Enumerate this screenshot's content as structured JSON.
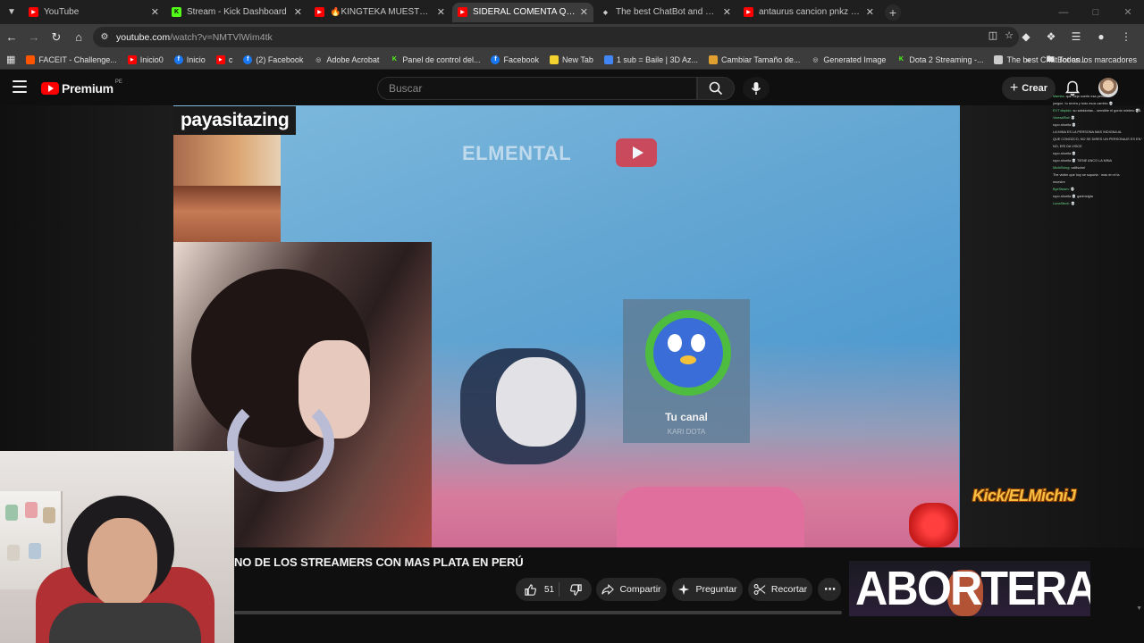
{
  "browser": {
    "tabs": [
      {
        "title": "YouTube",
        "icon": "youtube-favicon",
        "color": "#ff0000",
        "active": false
      },
      {
        "title": "Stream - Kick Dashboard",
        "icon": "kick-favicon",
        "color": "#53fc18",
        "active": false
      },
      {
        "title": "🔥KINGTEKA MUESTRA QUE M",
        "icon": "youtube-favicon",
        "color": "#ff0000",
        "active": false
      },
      {
        "title": "SIDERAL COMENTA QUE ZEIN E",
        "icon": "youtube-favicon",
        "color": "#ff0000",
        "active": true
      },
      {
        "title": "The best ChatBot and Widgets",
        "icon": "botrix-favicon",
        "color": "#cccccc",
        "active": false
      },
      {
        "title": "antaurus cancion pnkz - YouTu",
        "icon": "youtube-favicon",
        "color": "#ff0000",
        "active": false
      }
    ],
    "url_domain": "youtube.com",
    "url_path": "/watch?v=NMTVlWim4tk",
    "bookmarks": [
      {
        "label": "FACEIT - Challenge...",
        "icon": "faceit-icon",
        "color": "#ff5500"
      },
      {
        "label": "Inicio0",
        "icon": "youtube-icon",
        "color": "#ff0000"
      },
      {
        "label": "Inicio",
        "icon": "facebook-icon",
        "color": "#1877f2"
      },
      {
        "label": "c",
        "icon": "youtube-icon",
        "color": "#ff0000"
      },
      {
        "label": "(2) Facebook",
        "icon": "facebook-icon",
        "color": "#1877f2"
      },
      {
        "label": "Adobe Acrobat",
        "icon": "globe-icon",
        "color": "#9a9a9a"
      },
      {
        "label": "Panel de control del...",
        "icon": "kick-icon",
        "color": "#53fc18"
      },
      {
        "label": "Facebook",
        "icon": "facebook-icon",
        "color": "#1877f2"
      },
      {
        "label": "New Tab",
        "icon": "pixel-icon",
        "color": "#f2d22e"
      },
      {
        "label": "1 sub = Baile | 3D Az...",
        "icon": "translate-icon",
        "color": "#4285f4"
      },
      {
        "label": "Cambiar Tamaño de...",
        "icon": "dots-icon",
        "color": "#e0a030"
      },
      {
        "label": "Generated Image",
        "icon": "globe-icon",
        "color": "#9a9a9a"
      },
      {
        "label": "Dota 2 Streaming -...",
        "icon": "kick-icon",
        "color": "#53fc18"
      },
      {
        "label": "The best ChatBot an...",
        "icon": "botrix-icon",
        "color": "#cccccc"
      }
    ],
    "all_bookmarks_label": "Todos los marcadores"
  },
  "youtube": {
    "logo_text": "Premium",
    "logo_region": "PE",
    "search_placeholder": "Buscar",
    "create_label": "Crear",
    "video_title": "NO DE LOS STREAMERS CON MAS PLATA EN PERÚ",
    "like_count": "51",
    "share_label": "Compartir",
    "ask_label": "Preguntar",
    "clip_label": "Recortar"
  },
  "video_overlay": {
    "streamer_name": "payasitazing",
    "channel_watermark": "ELMENTAL",
    "sub_card_title": "Tu canal",
    "sub_card_sub": "KARI DOTA",
    "kick_tag": "Kick/ELMichiJ",
    "banner_text": "ABORTERA",
    "chat": [
      {
        "user": "Mamita",
        "msg": "que vieja suerte esa persona"
      },
      {
        "user": "",
        "msg": "juegue, tu sirvira y todo esos cambio 💀"
      },
      {
        "user": "EVT dispido",
        "msg": "su sabidurias... sensible el gordo mistero 💀"
      },
      {
        "user": "VioesaRiot",
        "msg": "💀"
      },
      {
        "user": "",
        "msg": "ropo ahorita 💀"
      },
      {
        "user": "",
        "msg": "LA MINA ES LA PERSONA MAS INDIGNA AL"
      },
      {
        "user": "",
        "msg": "QUE CONOZCO, NO SE DIRES UN PERSONAJE ES EN VIDA"
      },
      {
        "user": "",
        "msg": "NO, ERI DA VISCE"
      },
      {
        "user": "",
        "msg": "ropo ahorita 💀"
      },
      {
        "user": "",
        "msg": "ropo ahorita 💀 TIENE ANCO LA MINA"
      },
      {
        "user": "MichiSxing",
        "msg": "calfischel"
      },
      {
        "user": "",
        "msg": "The victim que hoy se soporta · mas en el la"
      },
      {
        "user": "",
        "msg": "muestre"
      },
      {
        "user": "ByeSteam",
        "msg": "💀"
      },
      {
        "user": "",
        "msg": "ropo ahorita 💀 garimelgta"
      },
      {
        "user": "LunaSteck",
        "msg": "💀"
      },
      {
        "user": "VioesaRiot",
        "msg": "💀"
      },
      {
        "user": "VioesaRiot",
        "msg": "💀"
      },
      {
        "user": "VioesaRiot",
        "msg": "💀"
      },
      {
        "user": "",
        "msg": "ropo ahorita 💀 se sabe ya"
      }
    ]
  }
}
